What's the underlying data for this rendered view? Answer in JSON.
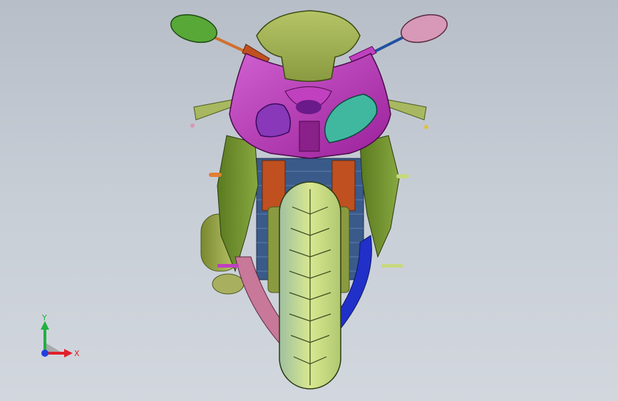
{
  "viewport": {
    "background_top": "#b7bec8",
    "background_bottom": "#d2d7de"
  },
  "triad": {
    "x_label": "X",
    "y_label": "Y",
    "x_color": "#e0202a",
    "y_color": "#20b040",
    "z_color": "#2040e0"
  },
  "model": {
    "description_icon": "motorcycle-front-model",
    "colors": {
      "windscreen": "#a8b85a",
      "fairing": "#c040c0",
      "side_panel": "#6a8a2a",
      "tire": "#c8d880",
      "radiator": "#3a5a8a",
      "fork": "#c05020",
      "mirror_left": "#58a838",
      "mirror_right": "#d898b8",
      "exhaust": "#9aa84a",
      "blue_panel": "#2030c8",
      "headlight_left": "#8838b8",
      "headlight_right": "#40b8a0"
    }
  }
}
